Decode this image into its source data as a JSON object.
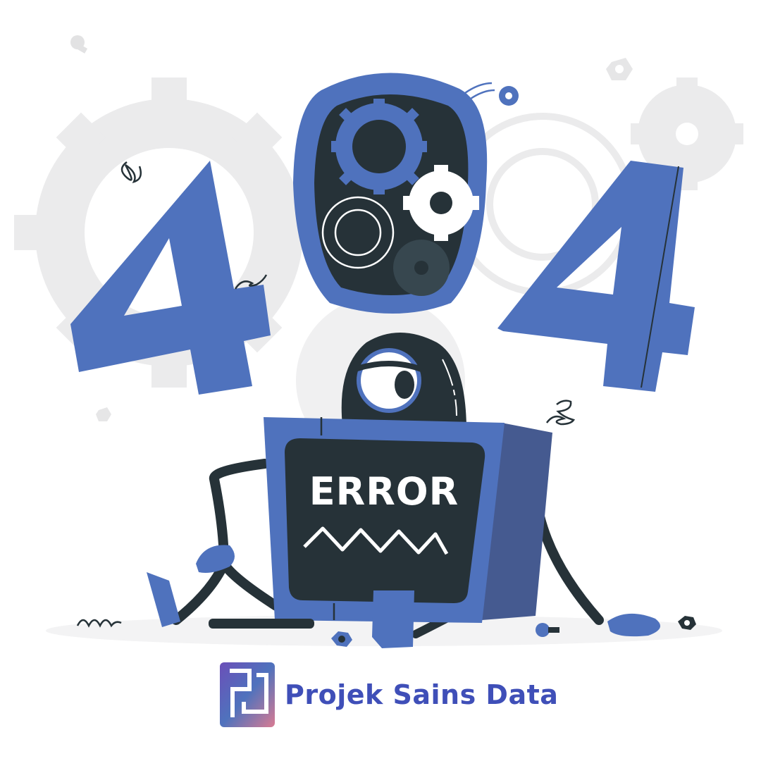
{
  "screen": {
    "text": "ERROR"
  },
  "brand": {
    "name": "Projek Sains Data"
  },
  "colors": {
    "blue": "#4f72bd",
    "dark": "#263238",
    "gear_gray": "#ebebec",
    "white": "#ffffff",
    "brand_blue": "#3f4fb8",
    "brand_pink": "#d97b92"
  },
  "icons": [
    "gear-icon",
    "bolt-icon",
    "nut-icon",
    "spring-icon"
  ]
}
